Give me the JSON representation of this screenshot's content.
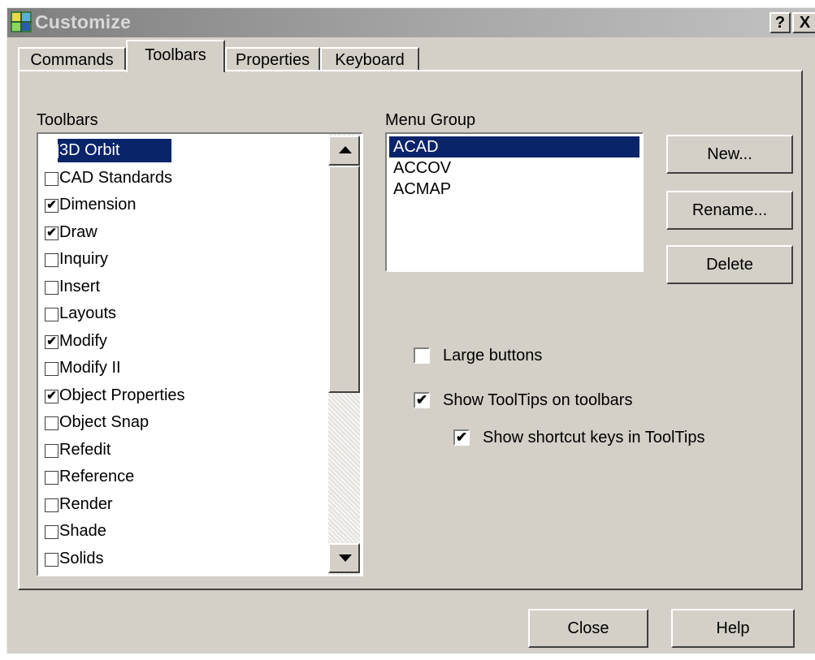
{
  "window": {
    "title": "Customize",
    "help_glyph": "?",
    "close_glyph": "X"
  },
  "tabs": [
    {
      "label": "Commands",
      "active": false
    },
    {
      "label": "Toolbars",
      "active": true
    },
    {
      "label": "Properties",
      "active": false
    },
    {
      "label": "Keyboard",
      "active": false
    }
  ],
  "toolbars_panel": {
    "label": "Toolbars",
    "items": [
      {
        "name": "3D Orbit",
        "checked": false,
        "selected": true
      },
      {
        "name": "CAD Standards",
        "checked": false,
        "selected": false
      },
      {
        "name": "Dimension",
        "checked": true,
        "selected": false
      },
      {
        "name": "Draw",
        "checked": true,
        "selected": false
      },
      {
        "name": "Inquiry",
        "checked": false,
        "selected": false
      },
      {
        "name": "Insert",
        "checked": false,
        "selected": false
      },
      {
        "name": "Layouts",
        "checked": false,
        "selected": false
      },
      {
        "name": "Modify",
        "checked": true,
        "selected": false
      },
      {
        "name": "Modify II",
        "checked": false,
        "selected": false
      },
      {
        "name": "Object Properties",
        "checked": true,
        "selected": false
      },
      {
        "name": "Object Snap",
        "checked": false,
        "selected": false
      },
      {
        "name": "Refedit",
        "checked": false,
        "selected": false
      },
      {
        "name": "Reference",
        "checked": false,
        "selected": false
      },
      {
        "name": "Render",
        "checked": false,
        "selected": false
      },
      {
        "name": "Shade",
        "checked": false,
        "selected": false
      },
      {
        "name": "Solids",
        "checked": false,
        "selected": false
      }
    ]
  },
  "menu_group": {
    "label": "Menu Group",
    "items": [
      {
        "name": "ACAD",
        "selected": true
      },
      {
        "name": "ACCOV",
        "selected": false
      },
      {
        "name": "ACMAP",
        "selected": false
      }
    ]
  },
  "buttons": {
    "new": "New...",
    "rename": "Rename...",
    "delete": "Delete",
    "close": "Close",
    "help": "Help"
  },
  "options": {
    "large_buttons": {
      "label": "Large buttons",
      "checked": false
    },
    "show_tooltips": {
      "label": "Show ToolTips on toolbars",
      "checked": true
    },
    "show_shortcut_keys": {
      "label": "Show shortcut keys in ToolTips",
      "checked": true
    }
  },
  "check_glyph": "✔",
  "colors": {
    "selection": "#0a246a",
    "face": "#d4d0c8"
  }
}
